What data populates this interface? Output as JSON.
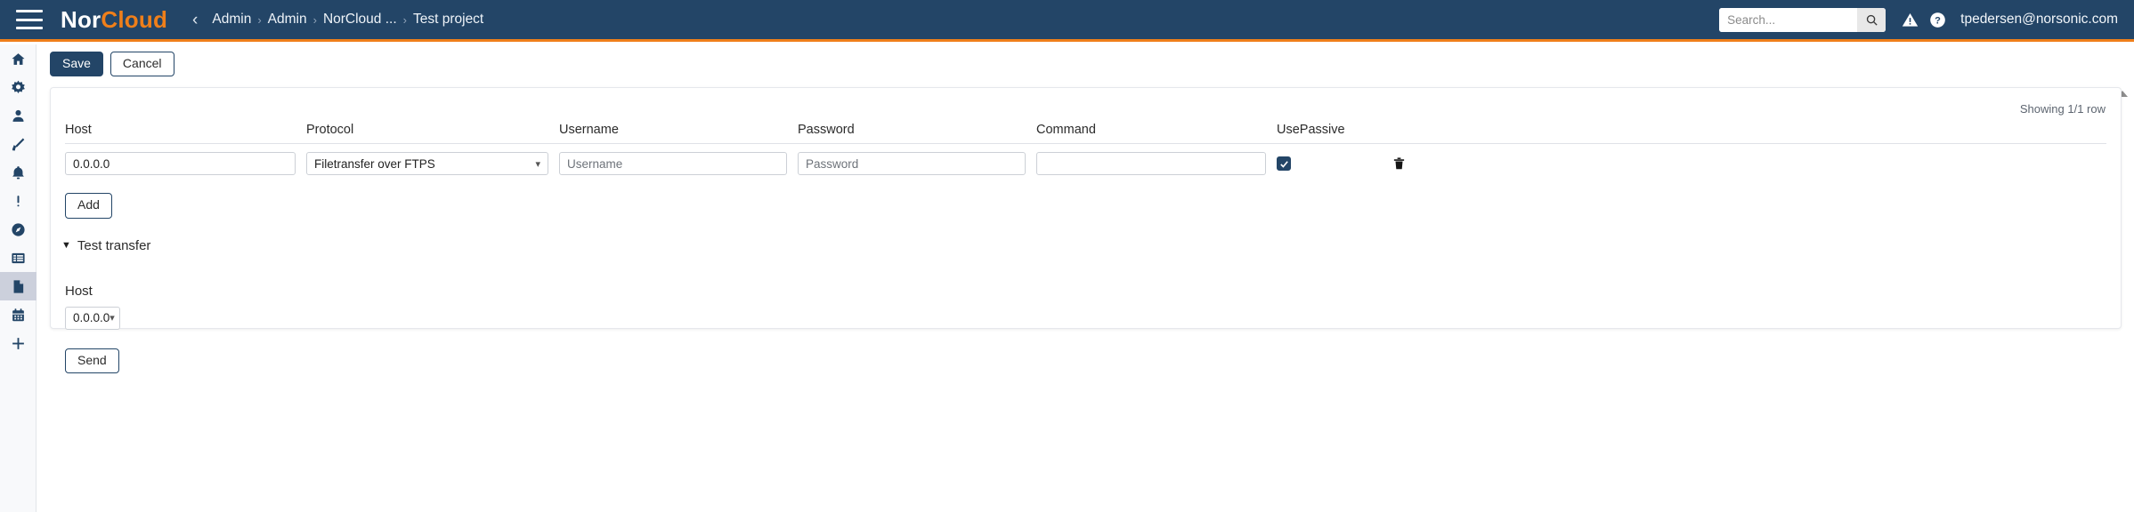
{
  "topbar": {
    "menu_icon": "hamburger-icon",
    "brand_part1": "Nor",
    "brand_part2": "Cloud",
    "back_chevron": "‹",
    "breadcrumbs": [
      {
        "label": "Admin"
      },
      {
        "label": "Admin"
      },
      {
        "label": "NorCloud ..."
      },
      {
        "label": "Test project"
      }
    ],
    "breadcrumb_separator": "›",
    "search": {
      "placeholder": "Search...",
      "value": "",
      "button_icon": "search-icon"
    },
    "warning_icon": "warning-triangle-icon",
    "help_icon": "help-circle-icon",
    "user_email": "tpedersen@norsonic.com"
  },
  "sidebar": {
    "items": [
      {
        "icon": "home-icon",
        "active": false
      },
      {
        "icon": "gear-icon",
        "active": false
      },
      {
        "icon": "person-icon",
        "active": false
      },
      {
        "icon": "microphone-icon",
        "active": false
      },
      {
        "icon": "bell-icon",
        "active": false
      },
      {
        "icon": "exclamation-icon",
        "active": false
      },
      {
        "icon": "compass-icon",
        "active": false
      },
      {
        "icon": "list-icon",
        "active": false
      },
      {
        "icon": "document-icon",
        "active": true
      },
      {
        "icon": "calendar-icon",
        "active": false
      },
      {
        "icon": "plus-icon",
        "active": false
      }
    ]
  },
  "actionbar": {
    "save_label": "Save",
    "cancel_label": "Cancel"
  },
  "panel": {
    "showing_text": "Showing 1/1 row",
    "columns": [
      "Host",
      "Protocol",
      "Username",
      "Password",
      "Command",
      "UsePassive"
    ],
    "rows": [
      {
        "host_value": "0.0.0.0",
        "host_placeholder": "",
        "protocol_value": "Filetransfer over FTPS",
        "username_value": "",
        "username_placeholder": "Username",
        "password_value": "",
        "password_placeholder": "Password",
        "command_value": "",
        "command_placeholder": "",
        "usepassive_checked": true,
        "delete_icon": "trash-icon"
      }
    ],
    "add_label": "Add",
    "test_transfer": {
      "toggle_arrow": "▼",
      "title": "Test transfer",
      "host_label": "Host",
      "host_value": "0.0.0.0",
      "send_label": "Send"
    }
  },
  "colors": {
    "header_bg": "#234567",
    "accent_orange": "#ef7f1a",
    "primary_button": "#234567",
    "sidebar_bg": "#f8f9fb",
    "sidebar_active": "#ccd0dc"
  }
}
